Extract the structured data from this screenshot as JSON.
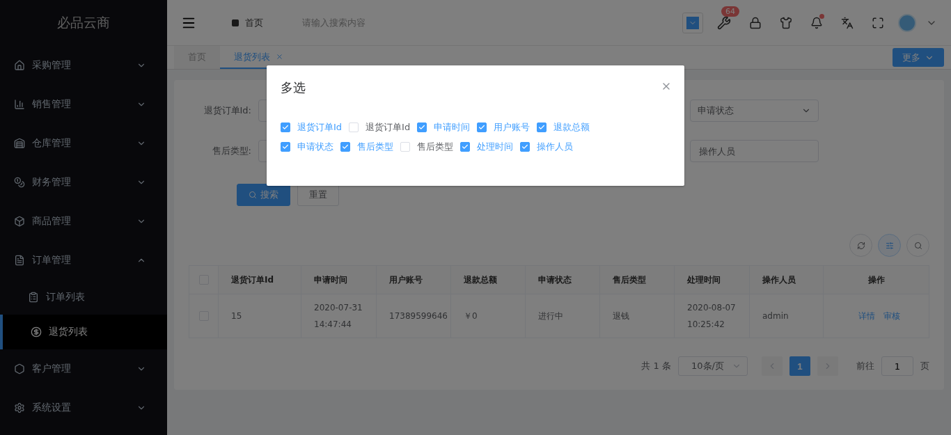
{
  "sidebar": {
    "logo": "必品云商",
    "items": [
      {
        "label": "采购管理",
        "expanded": false
      },
      {
        "label": "销售管理",
        "expanded": false
      },
      {
        "label": "仓库管理",
        "expanded": false
      },
      {
        "label": "财务管理",
        "expanded": false
      },
      {
        "label": "商品管理",
        "expanded": false
      },
      {
        "label": "订单管理",
        "expanded": true,
        "children": [
          {
            "label": "订单列表",
            "selected": false
          },
          {
            "label": "退货列表",
            "selected": true
          }
        ]
      },
      {
        "label": "客户管理",
        "expanded": false
      },
      {
        "label": "系统设置",
        "expanded": false
      }
    ]
  },
  "header": {
    "breadcrumb": "首页",
    "search": {
      "placeholder": "请输入搜索内容"
    },
    "badge": "64",
    "bell_dot": true
  },
  "tabs": [
    {
      "label": "首页",
      "selected": false
    },
    {
      "label": "退货列表",
      "selected": true
    }
  ],
  "more_button": "更多",
  "form": {
    "row1": {
      "label": "退货订单Id:",
      "right_placeholder": "申请状态"
    },
    "row2": {
      "label": "售后类型:",
      "right_placeholder": "操作人员"
    },
    "search_button": "搜索",
    "reset_button": "重置"
  },
  "table": {
    "header_checked": false,
    "columns": [
      "退货订单Id",
      "申请时间",
      "用户账号",
      "退款总额",
      "申请状态",
      "售后类型",
      "处理时间",
      "操作人员",
      "操作"
    ],
    "rows": [
      {
        "checked": false,
        "cells": [
          "15",
          "2020-07-31 14:47:44",
          "17389599646",
          "￥0",
          "进行中",
          "退钱",
          "2020-08-07 10:25:42",
          "admin"
        ],
        "actions": [
          "详情",
          "审核"
        ]
      }
    ]
  },
  "pagination": {
    "total": "共 1 条",
    "page_size": "10条/页",
    "current": "1",
    "goto_label": "前往",
    "goto_value": "1",
    "page_suffix": "页"
  },
  "dialog": {
    "title": "多选",
    "options": [
      {
        "label": "退货订单Id",
        "checked": true
      },
      {
        "label": "退货订单Id",
        "checked": false
      },
      {
        "label": "申请时间",
        "checked": true
      },
      {
        "label": "用户账号",
        "checked": true
      },
      {
        "label": "退款总额",
        "checked": true
      },
      {
        "label": "申请状态",
        "checked": true
      },
      {
        "label": "售后类型",
        "checked": true
      },
      {
        "label": "售后类型",
        "checked": false
      },
      {
        "label": "处理时间",
        "checked": true
      },
      {
        "label": "操作人员",
        "checked": true
      }
    ]
  }
}
